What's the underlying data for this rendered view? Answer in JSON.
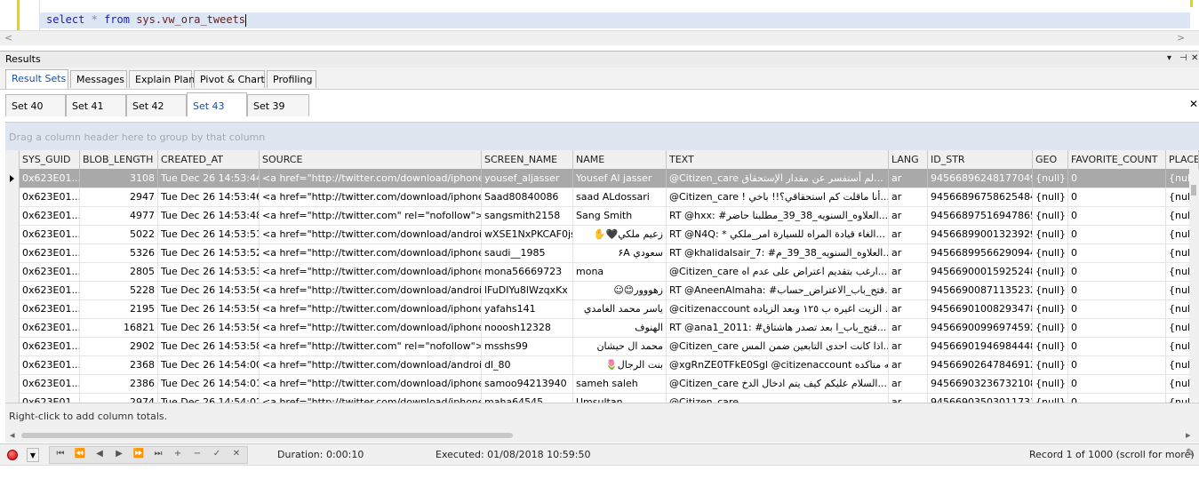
{
  "editor": {
    "keyword_select": "select",
    "op_star": "*",
    "keyword_from": "from",
    "object": "sys.vw_ora_tweets"
  },
  "results": {
    "title": "Results",
    "controls": [
      "▾",
      "⊣",
      "✕"
    ],
    "tabs": [
      "Result Sets",
      "Messages",
      "Explain Plan",
      "Pivot & Chart",
      "Profiling"
    ],
    "sets": [
      "Set 40",
      "Set 41",
      "Set 42",
      "Set 43",
      "Set 39"
    ],
    "close": "✕",
    "group_hint": "Drag a column header here to group by that column",
    "columns": [
      "SYS_GUID",
      "BLOB_LENGTH",
      "CREATED_AT",
      "SOURCE",
      "SCREEN_NAME",
      "NAME",
      "TEXT",
      "LANG",
      "ID_STR",
      "GEO",
      "FAVORITE_COUNT",
      "PLACE"
    ],
    "rows": [
      [
        "0x623E01...",
        "3108",
        "Tue Dec 26 14:53:44",
        "<a href=\"http://twitter.com/download/iphone\" ...",
        "yousef_aljasser",
        "Yousef Al jasser",
        "@Citizen_care لم أستفسر عن مقدار الإستحقاق...",
        "ar",
        "945668962481770497",
        "{null}",
        "0",
        "{nul"
      ],
      [
        "0x623E01...",
        "2947",
        "Tue Dec 26 14:53:46",
        "<a href=\"http://twitter.com/download/iphone\" ...",
        "Saad80840086",
        "saad ALdossari",
        "@Citizen_care ! أنا ماقلت كم استحقاقي؟!! باخي...",
        "ar",
        "945668967586254848",
        "{null}",
        "0",
        "{nul"
      ],
      [
        "0x623E01...",
        "4977",
        "Tue Dec 26 14:53:48",
        "<a href=\"http://twitter.com\" rel=\"nofollow\">T...",
        "sangsmith2158",
        "Sang Smith",
        "RT @hxx: #العلاوه_السنويه_38_39_مطلبنا حاضر...",
        "ar",
        "945668975169478656",
        "{null}",
        "0",
        "{nul"
      ],
      [
        "0x623E01...",
        "5022",
        "Tue Dec 26 14:53:51",
        "<a href=\"http://twitter.com/download/android\"...",
        "wXSE1NxPKCAF0js",
        "زعيم ملكي🖤✋",
        "RT @N4Q: * الغاء قيادة المراه للسيارة امر_ملكي...",
        "ar",
        "945668990013239297",
        "{null}",
        "0",
        "{nul"
      ],
      [
        "0x623E01...",
        "5326",
        "Tue Dec 26 14:53:52",
        "<a href=\"http://twitter.com/download/iphone\" ...",
        "saudi__1985",
        "سعودي ۶A",
        "RT @khalidalsair_7: #العلاوه_السنويه_38_39_م...",
        "ar",
        "945668995662909443",
        "{null}",
        "0",
        "{nul"
      ],
      [
        "0x623E01...",
        "2805",
        "Tue Dec 26 14:53:53",
        "<a href=\"http://twitter.com/download/iphone\" ...",
        "mona56669723",
        "mona",
        "@Citizen_care ارغب بتقديم اعتراض على عدم اه...",
        "ar",
        "945669000159252480",
        "{null}",
        "0",
        "{nul"
      ],
      [
        "0x623E01...",
        "5228",
        "Tue Dec 26 14:53:56",
        "<a href=\"http://twitter.com/download/android\"...",
        "lFuDIYu8lWzqxKx",
        "زهووور😊☺",
        "RT @AneenAlmaha: #فتح_باب_الاعتراض_حساب...",
        "ar",
        "945669008711352320",
        "{null}",
        "0",
        "{nul"
      ],
      [
        "0x623E01...",
        "2195",
        "Tue Dec 26 14:53:56",
        "<a href=\"http://twitter.com/download/iphone\" ...",
        "yafahs141",
        "ياسر محمد الغامدي",
        "@citizenaccount الزيت اغيره ب ١٢٥ وبعد الزياده ...",
        "ar",
        "945669010082934784",
        "{null}",
        "0",
        "{nul"
      ],
      [
        "0x623E01...",
        "16821",
        "Tue Dec 26 14:53:56",
        "<a href=\"http://twitter.com/download/iphone\" ...",
        "nooosh12328",
        "الهنوف",
        "RT @ana1_2011: #فتح_باب_ا بعد تصدر هاشتاق...",
        "ar",
        "945669009969745920",
        "{null}",
        "0",
        "{nul"
      ],
      [
        "0x623E01...",
        "2902",
        "Tue Dec 26 14:53:58",
        "<a href=\"http://twitter.com\" rel=\"nofollow\">T...",
        "msshs99",
        "محمد ال حيشان",
        "@Citizen_care اذا كانت احدى التابعين ضمن المس...",
        "ar",
        "945669019469844480",
        "{null}",
        "0",
        "{nul"
      ],
      [
        "0x623E01...",
        "2368",
        "Tue Dec 26 14:54:00",
        "<a href=\"http://twitter.com/download/android\"...",
        "dl_80",
        "بنت الرجال🌷",
        "@xgRnZE0TFkE0Sgl @citizenaccount دانه متاكده...",
        "ar",
        "945669026478469121",
        "{null}",
        "0",
        "{nul"
      ],
      [
        "0x623E01...",
        "2386",
        "Tue Dec 26 14:54:01",
        "<a href=\"http://twitter.com/download/iphone\" ...",
        "samoo94213940",
        "sameh saleh",
        "@Citizen_care السلام عليكم كيف يتم ادخال الدخ...",
        "ar",
        "945669032367321089",
        "{null}",
        "0",
        "{nul"
      ],
      [
        "0x623E01...",
        "2974",
        "Tue Dec 26 14:54:02",
        "<a href=\"http://twitter.com/download/iphone\" ...",
        "maha64545",
        "Umsultan",
        "@Citizen_care ...",
        "ar",
        "945669035030117312",
        "{null}",
        "0",
        "{nul"
      ]
    ],
    "totals_hint": "Right-click to add column totals."
  },
  "status": {
    "nav_buttons": [
      "⏮",
      "⏪",
      "◀",
      "▶",
      "⏩",
      "⏭",
      "+",
      "−",
      "✓",
      "✕"
    ],
    "duration": "Duration: 0:00:10",
    "executed": "Executed: 01/08/2018 10:59:50",
    "record": "Record 1 of 1000 (scroll for more)"
  },
  "colors": {
    "accent_blue": "#1a4d9c",
    "selected_row": "#a9a9a9",
    "group_bar": "#dfe6ef"
  }
}
